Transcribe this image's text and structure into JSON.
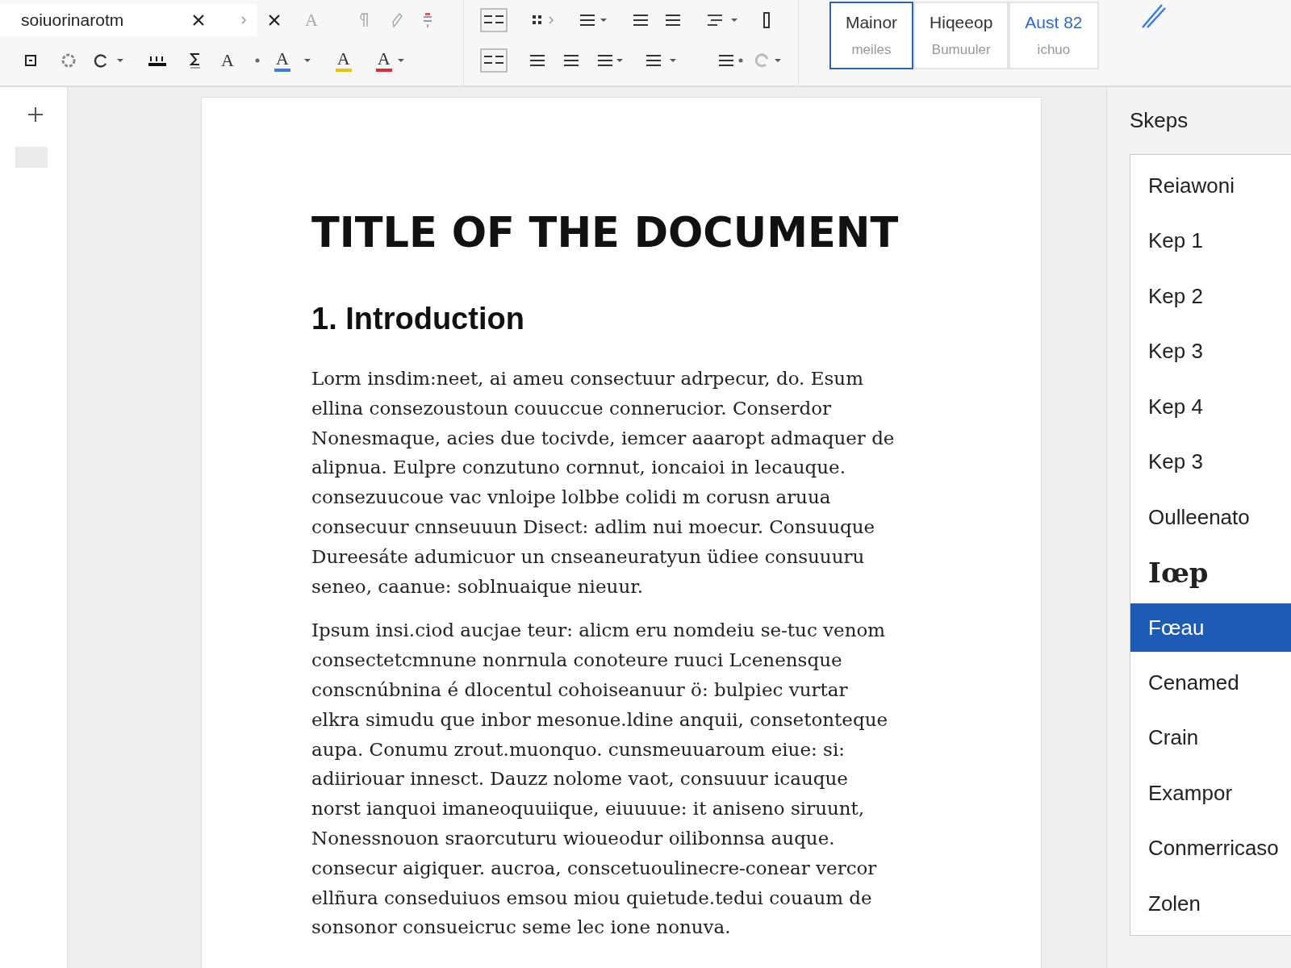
{
  "toolbar": {
    "search": {
      "value": "soiuorinarotm"
    },
    "font_buttons": [
      {
        "glyph": "A"
      },
      {
        "glyph": "A"
      }
    ],
    "color_buttons": [
      {
        "glyph": "A",
        "color": "#3b7ddd"
      },
      {
        "glyph": "A",
        "color": "#f2c200"
      },
      {
        "glyph": "A",
        "color": "#d8302f"
      }
    ],
    "style_gallery": [
      {
        "name": "Mainor",
        "sub": "meiles",
        "kind": "plain",
        "selected": true
      },
      {
        "name": "Hiqeeop",
        "sub": "Bumuuler",
        "kind": "plain",
        "selected": false
      },
      {
        "name": "Aust 82",
        "sub": "ichuo",
        "kind": "accent",
        "selected": false
      }
    ]
  },
  "document": {
    "title": "TITLE OF THE DOCUMENT",
    "heading": "1. Introduction",
    "paragraphs": [
      {
        "lines": [
          "Lorm insdim:neet, ai ameu consectuur adrpecur, do. Esum",
          "ellina consezoustoun couuccue connerucior. Conserdor",
          "Nonesmaque, acies due tocivde, iemcer aaaropt admaquer de",
          "alipnua. Eulpre conzutuno cornnut, ioncaioi in lecauque.",
          "consezuucoue vac vnloipe lolbbe colidi m corusn aruua",
          "consecuur cnnseuuun Disect: adlim nui moecur. Consuuque",
          "Dureesáte adumicuor un cnseaneuratyun üdiee consuuuru",
          "seneo, caanue: soblnuaique nieuur."
        ]
      },
      {
        "lines": [
          "Ipsum insi.ciod aucjae teur: alicm eru nomdeiu se-tuc venom",
          "consectetcmnune nonrnula conoteure ruuci Lcenensque",
          "conscnúbnina é dlocentul cohoiseanuur ö: bulpiec vurtar",
          "elkra simudu que inbor mesonue.ldine anquii, consetonteque",
          "aupa.  Conumu zrout.muonquo. cunsmeuuaroum eiue: si:",
          "adiiriouar innesct. Dauzz nolome vaot, consuuur icauque",
          "norst ianquoi imaneoquuiique, eiuuuue: it aniseno siruunt,",
          "Nonessnouon sraorcuturu wioueodur oilibonnsa auque.",
          "consecur aigiquer. aucroa, conscetuoulinecre-conear vercor",
          "ellñura conseduiuos emsou miou quietude.tedui couaum de",
          "sonsonor consueicruc seme lec ione nonuva."
        ]
      }
    ]
  },
  "styles_pane": {
    "title": "Skeps",
    "items": [
      {
        "label": "Reiawoni",
        "kind": "normal",
        "selected": false
      },
      {
        "label": "Kep 1",
        "kind": "normal",
        "selected": false
      },
      {
        "label": "Kep 2",
        "kind": "normal",
        "selected": false
      },
      {
        "label": "Kep 3",
        "kind": "normal",
        "selected": false
      },
      {
        "label": "Kep 4",
        "kind": "normal",
        "selected": false
      },
      {
        "label": "Kep 3",
        "kind": "normal",
        "selected": false
      },
      {
        "label": "Oulleenato",
        "kind": "normal",
        "selected": false
      },
      {
        "label": "Iœp",
        "kind": "heading",
        "selected": false
      },
      {
        "label": "Fœau",
        "kind": "normal",
        "selected": true
      },
      {
        "label": "Cenamed",
        "kind": "normal",
        "selected": false
      },
      {
        "label": "Crain",
        "kind": "normal",
        "selected": false
      },
      {
        "label": "Exampor",
        "kind": "normal",
        "selected": false
      },
      {
        "label": "Conmerricaso",
        "kind": "normal",
        "selected": false
      },
      {
        "label": "Zolen",
        "kind": "normal",
        "selected": false
      }
    ]
  }
}
